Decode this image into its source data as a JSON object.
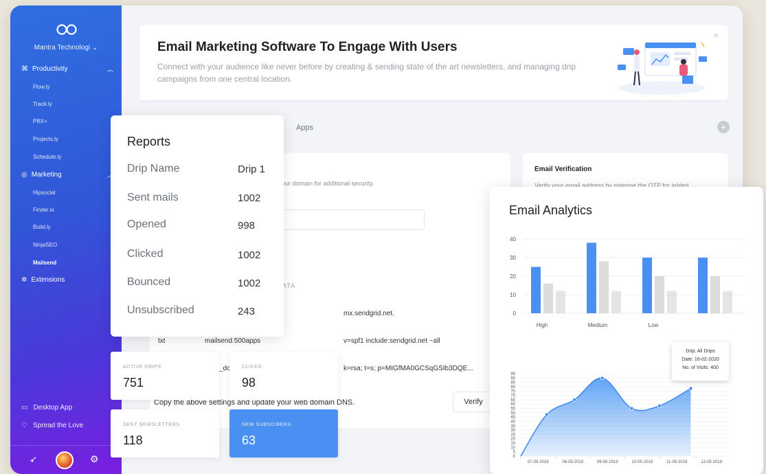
{
  "app": {
    "org_name": "Mantra Technologi"
  },
  "sidebar": {
    "sections": [
      {
        "label": "Productivity",
        "icon": "command-icon",
        "items": [
          "Flow.ly",
          "Track.ly",
          "PBX+",
          "Projects.ly",
          "Schedule.ly"
        ]
      },
      {
        "label": "Marketing",
        "icon": "globe-icon",
        "items": [
          "Hipsocial",
          "Finder.io",
          "Build.ly",
          "NinjaSEO",
          "Mailsend"
        ]
      },
      {
        "label": "Extensions",
        "icon": "settings-circle-icon",
        "items": []
      }
    ],
    "active_item": "Mailsend",
    "footer": [
      {
        "label": "Desktop App",
        "icon": "monitor-icon"
      },
      {
        "label": "Spread the Love",
        "icon": "heart-icon"
      }
    ]
  },
  "banner": {
    "title": "Email Marketing Software To Engage With Users",
    "description": "Connect with your audience like never before by creating & sending state of the art newsletters, and managing drip campaigns from one central location.",
    "close": "×"
  },
  "tabs": {
    "apps": "Apps",
    "add": "+"
  },
  "settings": {
    "domain_hint": "our domain for additional security.",
    "dns_header_fragment": "ATA",
    "records": [
      {
        "type": "",
        "host": "",
        "value": "mx.sendgrid.net."
      },
      {
        "type": "txt",
        "host": "mailsend.500apps",
        "value": "v=spf1 include:sendgrid.net ~all"
      },
      {
        "type": "",
        "host": "_dc",
        "value": "k=rsa; t=s; p=MIGfMA0GCSqGSIb3DQE..."
      }
    ],
    "copy_note": "Copy the above settings and update your web domain DNS.",
    "verify_label": "Verify"
  },
  "email_verification": {
    "title": "Email Verification",
    "text": "Verify your email address by enterine the OTP for added"
  },
  "reports": {
    "title": "Reports",
    "rows": [
      {
        "label": "Drip Name",
        "value": "Drip 1"
      },
      {
        "label": "Sent mails",
        "value": "1002"
      },
      {
        "label": "Opened",
        "value": "998"
      },
      {
        "label": "Clicked",
        "value": "1002"
      },
      {
        "label": "Bounced",
        "value": "1002"
      },
      {
        "label": "Unsubscribed",
        "value": "243"
      }
    ]
  },
  "stats": [
    {
      "label": "ACTIVE DRIPS",
      "value": "751"
    },
    {
      "label": "CLICKS",
      "value": "98"
    },
    {
      "label": "SENT NEWSLETTERS",
      "value": "118"
    },
    {
      "label": "NEW SUBSCIBERS",
      "value": "63"
    }
  ],
  "analytics": {
    "title": "Email Analytics",
    "tooltip": {
      "line1": "Drip: All Drips",
      "line2": "Date: 16-02-2020",
      "line3": "No. of Visits: 400"
    }
  },
  "colors": {
    "accent_blue": "#4a90f2",
    "bar_light": "#dcdcdc",
    "area_fill": "#5aa0f4"
  },
  "chart_data": [
    {
      "type": "bar",
      "title": "",
      "categories": [
        "High",
        "Medium",
        "Low",
        ""
      ],
      "series": [
        {
          "values": [
            25,
            38,
            30,
            30
          ]
        },
        {
          "values": [
            16,
            28,
            20,
            20
          ]
        },
        {
          "values": [
            12,
            12,
            12,
            12
          ]
        }
      ],
      "ylim": [
        0,
        40
      ],
      "yticks": [
        0,
        10,
        20,
        30,
        40
      ],
      "grid": true
    },
    {
      "type": "area",
      "title": "",
      "x": [
        "07-05-2019",
        "08-05-2019",
        "09-05-2019",
        "10-05-2019",
        "11-05-2019",
        "12-05-2019"
      ],
      "series": [
        {
          "values": [
            0,
            48,
            65,
            90,
            55,
            58,
            78
          ]
        }
      ],
      "point_positions": [
        0,
        0.75,
        1.55,
        2.35,
        3.2,
        4.0,
        4.9
      ],
      "ylim": [
        0,
        95
      ],
      "yticks": [
        0,
        5,
        10,
        15,
        20,
        25,
        30,
        35,
        40,
        45,
        50,
        55,
        60,
        65,
        70,
        75,
        80,
        85,
        90,
        95
      ],
      "grid": true
    }
  ]
}
